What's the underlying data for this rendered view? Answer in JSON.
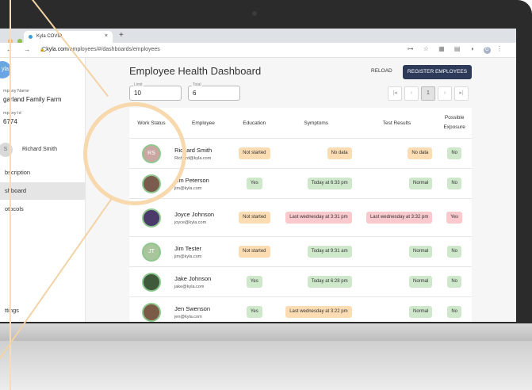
{
  "browser": {
    "tab_title": "Kyla COVID",
    "tab_close": "×",
    "new_tab": "+",
    "nav": "←  →  C",
    "lock": "🔒",
    "url_host": "kyla.com",
    "url_path": "/employees/#/dashboards/employees",
    "extensions": "⊶ ☆ ▦ ▤ ◑",
    "profile_initial": "G",
    "menu": "⋮"
  },
  "sidebar": {
    "logo_text": "yla",
    "company_name_label": "mpany Name",
    "company_name": "garland Family Farm",
    "company_id_label": "mpany Id",
    "company_id": "6774",
    "user_initials": "S",
    "user_name": "Richard Smith",
    "items": [
      {
        "label": "bscription"
      },
      {
        "label": "shboard"
      },
      {
        "label": "otocols"
      },
      {
        "label": "ttings"
      }
    ]
  },
  "header": {
    "title": "Employee Health Dashboard",
    "reload": "RELOAD",
    "register": "REGISTER EMPLOYEES"
  },
  "filters": {
    "limit_label": "Limit",
    "limit_value": "10",
    "total_label": "Total",
    "total_value": "6"
  },
  "pagination": {
    "first": "|◂",
    "prev": "‹",
    "current": "1",
    "next": "›",
    "last": "▸|"
  },
  "table": {
    "headers": [
      "Work Status",
      "Employee",
      "Education",
      "Symptoms",
      "Test Results",
      "Possible Exposure"
    ],
    "rows": [
      {
        "initials": "RS",
        "name": "Richard Smith",
        "email": "Richard@kyla.com",
        "education": "Not started",
        "symptoms": "No data",
        "test": "No data",
        "exposure": "No"
      },
      {
        "initials": "",
        "name": "Jim Peterson",
        "email": "jim@kyla.com",
        "education": "Yes",
        "symptoms": "Today at 6:33 pm",
        "test": "Normal",
        "exposure": "No"
      },
      {
        "initials": "",
        "name": "Joyce Johnson",
        "email": "joyce@kyla.com",
        "education": "Not started",
        "symptoms": "Last wednesday at 3:31 pm",
        "test": "Last wednesday at 3:32 pm",
        "exposure": "Yes"
      },
      {
        "initials": "JT",
        "name": "Jim Tester",
        "email": "jim@kyla.com",
        "education": "Not started",
        "symptoms": "Today at 9:31 am",
        "test": "Normal",
        "exposure": "No"
      },
      {
        "initials": "",
        "name": "Jake Johnson",
        "email": "jake@kyla.com",
        "education": "Yes",
        "symptoms": "Today at 6:28 pm",
        "test": "Normal",
        "exposure": "No"
      },
      {
        "initials": "",
        "name": "Jen Swenson",
        "email": "jen@kyla.com",
        "education": "Yes",
        "symptoms": "Last wednesday at 3:22 pm",
        "test": "Normal",
        "exposure": "No"
      }
    ]
  },
  "colors": {
    "green_pill": "#cfe8cc",
    "orange_pill": "#fbdcb3",
    "red_pill": "#f9c9ce",
    "brand": "#2d3a5a",
    "highlight_ring": "#f8d8ad"
  }
}
